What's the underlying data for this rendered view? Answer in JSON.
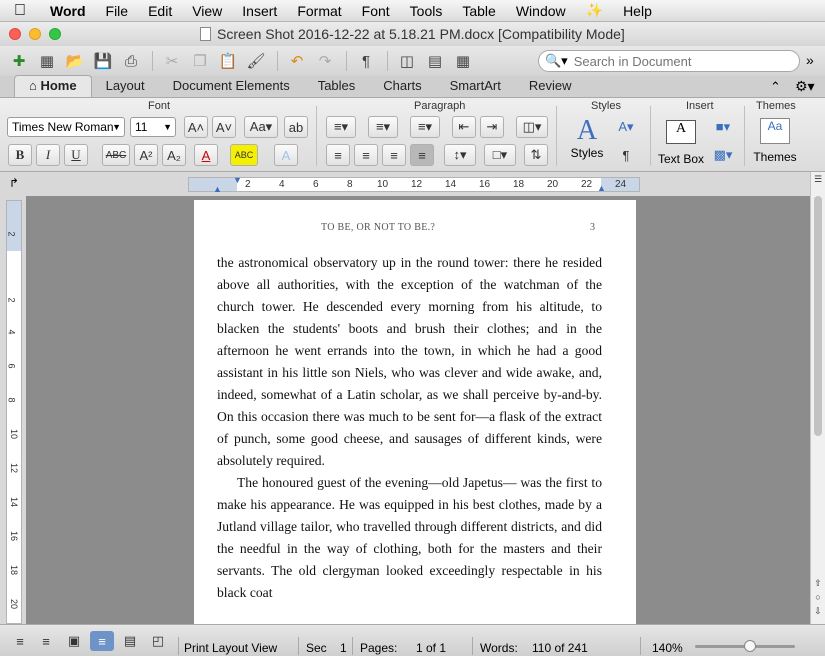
{
  "menubar": {
    "app": "Word",
    "items": [
      "File",
      "Edit",
      "View",
      "Insert",
      "Format",
      "Font",
      "Tools",
      "Table",
      "Window",
      "Help"
    ]
  },
  "window": {
    "title": "Screen Shot 2016-12-22 at 5.18.21 PM.docx [Compatibility Mode]"
  },
  "search": {
    "placeholder": "Search in Document"
  },
  "ribbon": {
    "tabs": [
      "Home",
      "Layout",
      "Document Elements",
      "Tables",
      "Charts",
      "SmartArt",
      "Review"
    ],
    "groups": {
      "font": "Font",
      "paragraph": "Paragraph",
      "styles": "Styles",
      "insert": "Insert",
      "themes": "Themes"
    },
    "font_name": "Times New Roman",
    "font_size": "11",
    "styles_label": "Styles",
    "textbox_label": "Text Box",
    "themes_label": "Themes"
  },
  "ruler": {
    "h_ticks": [
      "2",
      "4",
      "6",
      "8",
      "10",
      "12",
      "14",
      "16",
      "18",
      "20",
      "22",
      "24"
    ],
    "v_ticks": [
      "2",
      "2",
      "4",
      "6",
      "8",
      "10",
      "12",
      "14",
      "16",
      "18",
      "20"
    ]
  },
  "document": {
    "running_head": "TO BE, OR NOT TO BE.?",
    "page_number": "3",
    "paragraph1": "the astronomical observatory up in the round tower: there he resided above all authorities, with the exception of the watchman of the church tower. He descended every morning from his altitude, to blacken the students' boots and brush their clothes; and in the afternoon he went errands into the town, in which he had a good assistant in his little son Niels, who was clever and wide awake, and, indeed, somewhat of a Latin scholar, as we shall perceive by-and-by. On this occasion there was much to be sent for—a flask of the extract of punch, some good cheese, and sausages of different kinds, were absolutely required.",
    "paragraph2": "The honoured guest of the evening—old Japetus— was the first to make his appearance. He was equipped in his best clothes, made by a Jutland village tailor, who travelled through different districts, and did the needful in the way of clothing, both for the masters and their servants. The old clergyman looked exceedingly respectable in his black coat"
  },
  "status": {
    "view": "Print Layout View",
    "sec_label": "Sec",
    "sec_value": "1",
    "pages_label": "Pages:",
    "pages_value": "1 of 1",
    "words_label": "Words:",
    "words_value": "110 of 241",
    "zoom": "140%"
  }
}
